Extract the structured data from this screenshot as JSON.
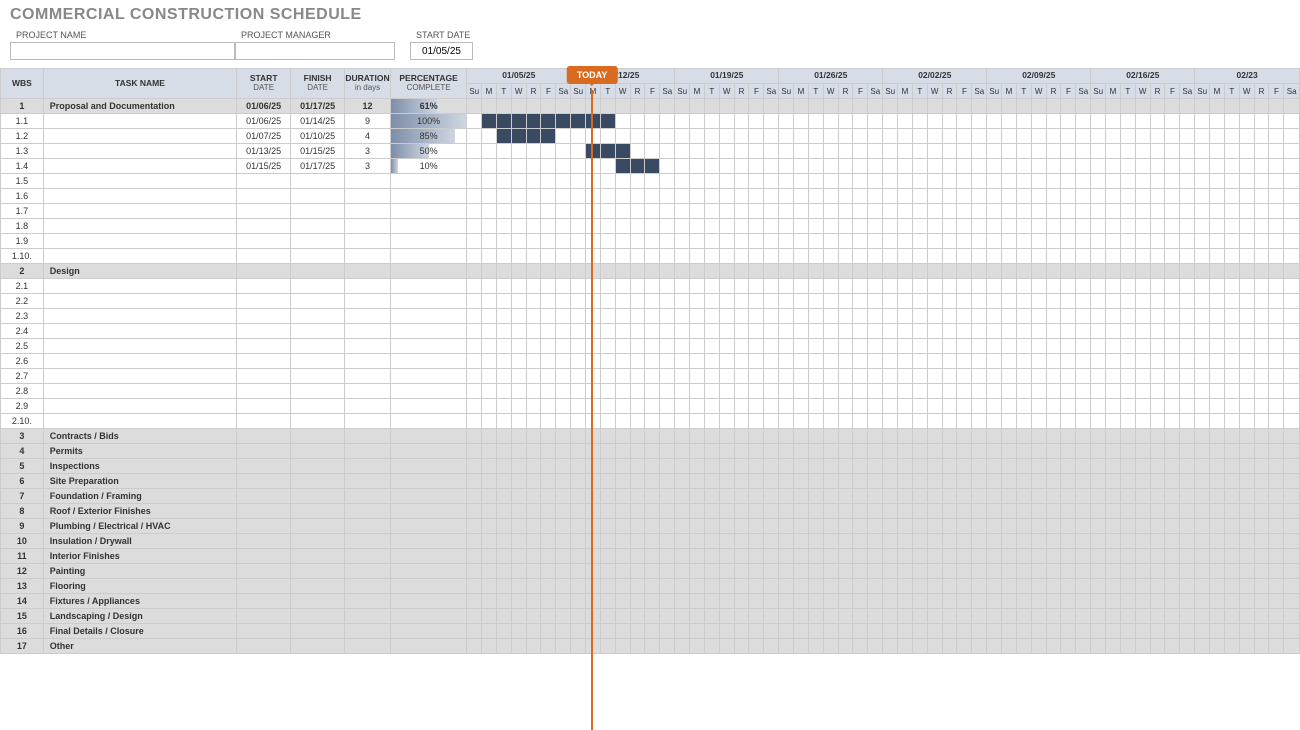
{
  "title": "COMMERCIAL CONSTRUCTION SCHEDULE",
  "meta": {
    "project_name_label": "PROJECT NAME",
    "project_name": "",
    "project_manager_label": "PROJECT MANAGER",
    "project_manager": "",
    "start_date_label": "START DATE",
    "start_date": "01/05/25"
  },
  "today_label": "TODAY",
  "today_date": "01/13/25",
  "columns": {
    "wbs": "WBS",
    "task": "TASK NAME",
    "start": "START",
    "start_sub": "DATE",
    "finish": "FINISH",
    "finish_sub": "DATE",
    "duration": "DURATION",
    "duration_sub": "in days",
    "percent": "PERCENTAGE",
    "percent_sub": "COMPLETE"
  },
  "timeline": {
    "start": "01/05/25",
    "weeks": [
      "01/05/25",
      "01/12/25",
      "01/19/25",
      "01/26/25",
      "02/02/25",
      "02/09/25",
      "02/16/25",
      "02/23"
    ],
    "days": [
      "Su",
      "M",
      "T",
      "W",
      "R",
      "F",
      "Sa"
    ]
  },
  "rows": [
    {
      "wbs": "1",
      "task": "Proposal and Documentation",
      "start": "01/06/25",
      "finish": "01/17/25",
      "dur": "12",
      "pct": 61,
      "section": true
    },
    {
      "wbs": "1.1",
      "task": "",
      "start": "01/06/25",
      "finish": "01/14/25",
      "dur": "9",
      "pct": 100,
      "bar_start": 1,
      "bar_len": 9
    },
    {
      "wbs": "1.2",
      "task": "",
      "start": "01/07/25",
      "finish": "01/10/25",
      "dur": "4",
      "pct": 85,
      "bar_start": 2,
      "bar_len": 4
    },
    {
      "wbs": "1.3",
      "task": "",
      "start": "01/13/25",
      "finish": "01/15/25",
      "dur": "3",
      "pct": 50,
      "bar_start": 8,
      "bar_len": 3
    },
    {
      "wbs": "1.4",
      "task": "",
      "start": "01/15/25",
      "finish": "01/17/25",
      "dur": "3",
      "pct": 10,
      "bar_start": 10,
      "bar_len": 3
    },
    {
      "wbs": "1.5"
    },
    {
      "wbs": "1.6"
    },
    {
      "wbs": "1.7"
    },
    {
      "wbs": "1.8"
    },
    {
      "wbs": "1.9"
    },
    {
      "wbs": "1.10."
    },
    {
      "wbs": "2",
      "task": "Design",
      "section": true
    },
    {
      "wbs": "2.1"
    },
    {
      "wbs": "2.2"
    },
    {
      "wbs": "2.3"
    },
    {
      "wbs": "2.4"
    },
    {
      "wbs": "2.5"
    },
    {
      "wbs": "2.6"
    },
    {
      "wbs": "2.7"
    },
    {
      "wbs": "2.8"
    },
    {
      "wbs": "2.9"
    },
    {
      "wbs": "2.10."
    },
    {
      "wbs": "3",
      "task": "Contracts / Bids",
      "collapsed": true
    },
    {
      "wbs": "4",
      "task": "Permits",
      "collapsed": true
    },
    {
      "wbs": "5",
      "task": "Inspections",
      "collapsed": true
    },
    {
      "wbs": "6",
      "task": "Site Preparation",
      "collapsed": true
    },
    {
      "wbs": "7",
      "task": "Foundation / Framing",
      "collapsed": true
    },
    {
      "wbs": "8",
      "task": "Roof / Exterior Finishes",
      "collapsed": true
    },
    {
      "wbs": "9",
      "task": "Plumbing / Electrical / HVAC",
      "collapsed": true
    },
    {
      "wbs": "10",
      "task": "Insulation / Drywall",
      "collapsed": true
    },
    {
      "wbs": "11",
      "task": "Interior Finishes",
      "collapsed": true
    },
    {
      "wbs": "12",
      "task": "Painting",
      "collapsed": true
    },
    {
      "wbs": "13",
      "task": "Flooring",
      "collapsed": true
    },
    {
      "wbs": "14",
      "task": "Fixtures / Appliances",
      "collapsed": true
    },
    {
      "wbs": "15",
      "task": "Landscaping / Design",
      "collapsed": true
    },
    {
      "wbs": "16",
      "task": "Final Details / Closure",
      "collapsed": true
    },
    {
      "wbs": "17",
      "task": "Other",
      "collapsed": true
    }
  ]
}
